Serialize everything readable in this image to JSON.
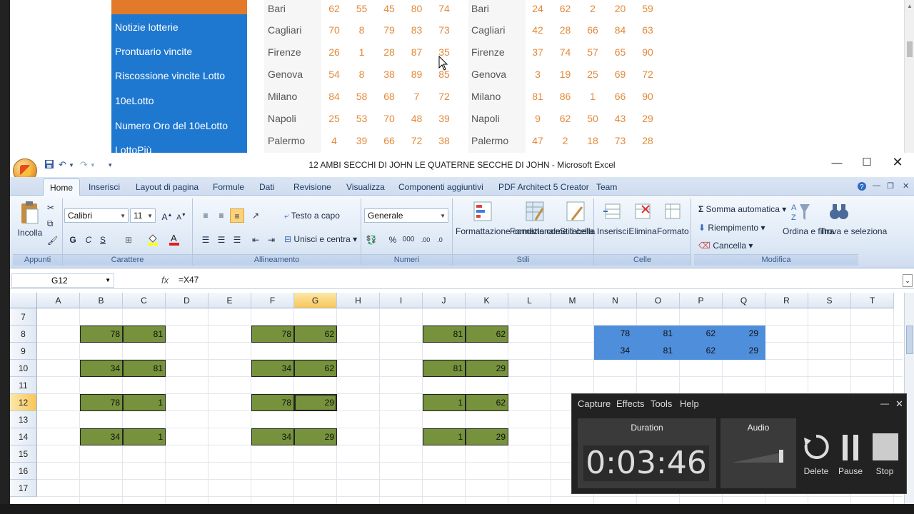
{
  "web": {
    "menu": [
      "Notizie lotterie",
      "Prontuario vincite",
      "Riscossione vincite Lotto",
      "10eLotto",
      "Numero Oro del 10eLotto",
      "LottoPiù"
    ],
    "table1": [
      {
        "city": "Bari",
        "nums": [
          "62",
          "55",
          "45",
          "80",
          "74"
        ]
      },
      {
        "city": "Cagliari",
        "nums": [
          "70",
          "8",
          "79",
          "83",
          "73"
        ]
      },
      {
        "city": "Firenze",
        "nums": [
          "26",
          "1",
          "28",
          "87",
          "35"
        ]
      },
      {
        "city": "Genova",
        "nums": [
          "54",
          "8",
          "38",
          "89",
          "85"
        ]
      },
      {
        "city": "Milano",
        "nums": [
          "84",
          "58",
          "68",
          "7",
          "72"
        ]
      },
      {
        "city": "Napoli",
        "nums": [
          "25",
          "53",
          "70",
          "48",
          "39"
        ]
      },
      {
        "city": "Palermo",
        "nums": [
          "4",
          "39",
          "66",
          "72",
          "38"
        ]
      }
    ],
    "table2": [
      {
        "city": "Bari",
        "nums": [
          "24",
          "62",
          "2",
          "20",
          "59"
        ]
      },
      {
        "city": "Cagliari",
        "nums": [
          "42",
          "28",
          "66",
          "84",
          "63"
        ]
      },
      {
        "city": "Firenze",
        "nums": [
          "37",
          "74",
          "57",
          "65",
          "90"
        ]
      },
      {
        "city": "Genova",
        "nums": [
          "3",
          "19",
          "25",
          "69",
          "72"
        ]
      },
      {
        "city": "Milano",
        "nums": [
          "81",
          "86",
          "1",
          "66",
          "90"
        ]
      },
      {
        "city": "Napoli",
        "nums": [
          "9",
          "62",
          "50",
          "43",
          "29"
        ]
      },
      {
        "city": "Palermo",
        "nums": [
          "47",
          "2",
          "18",
          "73",
          "28"
        ]
      }
    ]
  },
  "excel": {
    "title": "12 AMBI SECCHI DI JOHN LE QUATERNE SECCHE DI JOHN - Microsoft Excel",
    "tabs": [
      "Home",
      "Inserisci",
      "Layout di pagina",
      "Formule",
      "Dati",
      "Revisione",
      "Visualizza",
      "Componenti aggiuntivi",
      "PDF Architect 5 Creator",
      "Team"
    ],
    "ribbon": {
      "appunti": {
        "incolla": "Incolla",
        "label": "Appunti"
      },
      "carattere": {
        "font": "Calibri",
        "size": "11",
        "bold": "G",
        "italic": "C",
        "underline": "S",
        "label": "Carattere"
      },
      "allineamento": {
        "testo_a_capo": "Testo a capo",
        "unisci": "Unisci e centra",
        "label": "Allineamento"
      },
      "numeri": {
        "format": "Generale",
        "percent": "%",
        "thousands": "000",
        "label": "Numeri"
      },
      "stili": {
        "cond": "Formattazione condizionale",
        "tabella": "Formatta come tabella",
        "cella": "Stili cella",
        "label": "Stili"
      },
      "celle": {
        "inserisci": "Inserisci",
        "elimina": "Elimina",
        "formato": "Formato",
        "label": "Celle"
      },
      "modifica": {
        "somma": "Somma automatica",
        "riempimento": "Riempimento",
        "cancella": "Cancella",
        "ordina": "Ordina e filtra",
        "trova": "Trova e seleziona",
        "label": "Modifica"
      }
    },
    "namebox": "G12",
    "fx": "fx",
    "formula": "=X47",
    "columns": [
      "A",
      "B",
      "C",
      "D",
      "E",
      "F",
      "G",
      "H",
      "I",
      "J",
      "K",
      "L",
      "M",
      "N",
      "O",
      "P",
      "Q",
      "R",
      "S",
      "T"
    ],
    "rows": [
      "7",
      "8",
      "9",
      "10",
      "11",
      "12",
      "13",
      "14",
      "15",
      "16",
      "17"
    ],
    "cells": {
      "B8": "78",
      "C8": "81",
      "F8": "78",
      "G8": "62",
      "J8": "81",
      "K8": "62",
      "B10": "34",
      "C10": "81",
      "F10": "34",
      "G10": "62",
      "J10": "81",
      "K10": "29",
      "B12": "78",
      "C12": "1",
      "F12": "78",
      "G12": "29",
      "J12": "1",
      "K12": "62",
      "B14": "34",
      "C14": "1",
      "F14": "34",
      "G14": "29",
      "J14": "1",
      "K14": "29",
      "N8": "78",
      "O8": "81",
      "P8": "62",
      "Q8": "29",
      "N9": "34",
      "O9": "81",
      "P9": "62",
      "Q9": "29"
    }
  },
  "recorder": {
    "menu": [
      "Capture",
      "Effects",
      "Tools",
      "Help"
    ],
    "duration_label": "Duration",
    "audio_label": "Audio",
    "time": "0:03:46",
    "delete": "Delete",
    "pause": "Pause",
    "stop": "Stop"
  }
}
